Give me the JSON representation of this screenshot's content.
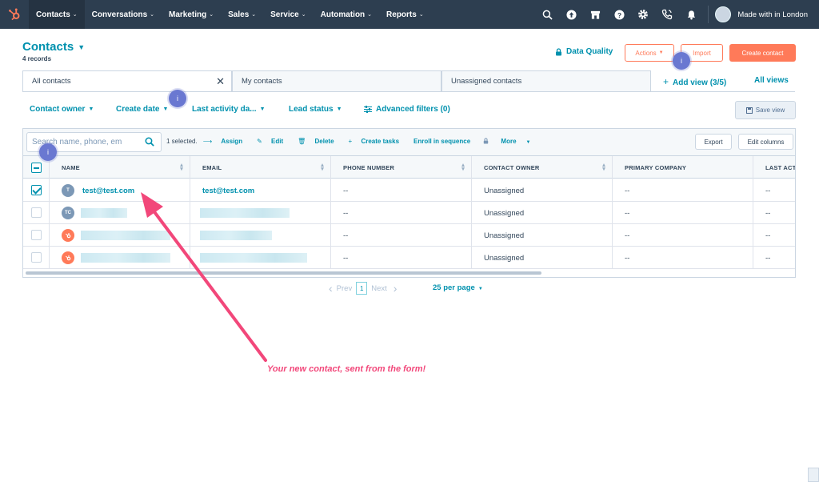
{
  "nav": {
    "items": [
      {
        "label": "Contacts",
        "active": true
      },
      {
        "label": "Conversations",
        "active": false
      },
      {
        "label": "Marketing",
        "active": false
      },
      {
        "label": "Sales",
        "active": false
      },
      {
        "label": "Service",
        "active": false
      },
      {
        "label": "Automation",
        "active": false
      },
      {
        "label": "Reports",
        "active": false
      }
    ],
    "account": "Made with in London"
  },
  "header": {
    "title": "Contacts",
    "records": "4 records",
    "data_quality": "Data Quality",
    "actions": "Actions",
    "import": "Import",
    "create": "Create contact"
  },
  "tabs": {
    "items": [
      "All contacts",
      "My contacts",
      "Unassigned contacts"
    ],
    "add_view": "Add view (3/5)",
    "all_views": "All views"
  },
  "filters": {
    "owner": "Contact owner",
    "create_date": "Create date",
    "last_activity": "Last activity da...",
    "lead_status": "Lead status",
    "advanced": "Advanced filters (0)",
    "save_view": "Save view"
  },
  "toolbar": {
    "search_placeholder": "Search name, phone, em",
    "selected": "1 selected.",
    "assign": "Assign",
    "edit": "Edit",
    "delete": "Delete",
    "create_tasks": "Create tasks",
    "enroll": "Enroll in sequence",
    "more": "More",
    "export": "Export",
    "edit_columns": "Edit columns"
  },
  "columns": [
    "NAME",
    "EMAIL",
    "PHONE NUMBER",
    "CONTACT OWNER",
    "PRIMARY COMPANY",
    "LAST ACT"
  ],
  "rows": [
    {
      "avatar": "T",
      "name": "test@test.com",
      "email": "test@test.com",
      "phone": "--",
      "owner": "Unassigned",
      "company": "--",
      "last": "--"
    },
    {
      "avatar": "TC",
      "name": "",
      "email": "",
      "phone": "--",
      "owner": "Unassigned",
      "company": "--",
      "last": "--"
    },
    {
      "avatar": "",
      "name": "",
      "email": "",
      "phone": "--",
      "owner": "Unassigned",
      "company": "--",
      "last": "--"
    },
    {
      "avatar": "",
      "name": "",
      "email": "",
      "phone": "--",
      "owner": "Unassigned",
      "company": "--",
      "last": "--"
    }
  ],
  "pagination": {
    "prev": "Prev",
    "page": "1",
    "next": "Next",
    "per_page": "25 per page"
  },
  "tour_badge": "i",
  "annotation": "Your new contact, sent from the form!",
  "colors": {
    "nav_bg": "#2d3e50",
    "accent": "#0091ae",
    "brand_orange": "#ff7a59",
    "annotation": "#f2477a",
    "badge": "#6a78d1"
  }
}
